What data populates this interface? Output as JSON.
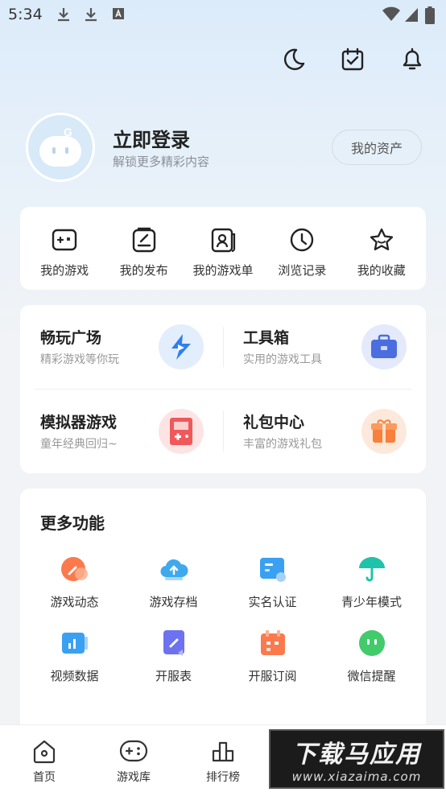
{
  "status_bar": {
    "time": "5:34"
  },
  "top_actions": {
    "night_mode": "moon-icon",
    "checkin": "calendar-check-icon",
    "notifications": "bell-icon"
  },
  "profile": {
    "title": "立即登录",
    "subtitle": "解锁更多精彩内容",
    "assets_button": "我的资产"
  },
  "quick_links": [
    {
      "label": "我的游戏",
      "icon": "gamepad-icon"
    },
    {
      "label": "我的发布",
      "icon": "edit-icon"
    },
    {
      "label": "我的游戏单",
      "icon": "game-list-icon"
    },
    {
      "label": "浏览记录",
      "icon": "clock-icon"
    },
    {
      "label": "我的收藏",
      "icon": "star-icon"
    }
  ],
  "features": [
    {
      "title": "畅玩广场",
      "subtitle": "精彩游戏等你玩",
      "icon": "lightning-play-icon",
      "color": "#2f7ff0"
    },
    {
      "title": "工具箱",
      "subtitle": "实用的游戏工具",
      "icon": "toolbox-icon",
      "color": "#4a6ee0"
    },
    {
      "title": "模拟器游戏",
      "subtitle": "童年经典回归~",
      "icon": "emulator-icon",
      "color": "#f0585a"
    },
    {
      "title": "礼包中心",
      "subtitle": "丰富的游戏礼包",
      "icon": "gift-icon",
      "color": "#f7803c"
    }
  ],
  "more": {
    "title": "更多功能",
    "items": [
      {
        "label": "游戏动态",
        "icon": "game-news-icon",
        "color": "#fa7a4e"
      },
      {
        "label": "游戏存档",
        "icon": "cloud-upload-icon",
        "color": "#3fa9ee"
      },
      {
        "label": "实名认证",
        "icon": "id-card-icon",
        "color": "#3aa0f2"
      },
      {
        "label": "青少年模式",
        "icon": "umbrella-icon",
        "color": "#1fc3a9"
      },
      {
        "label": "视频数据",
        "icon": "video-data-icon",
        "color": "#3aa0f2"
      },
      {
        "label": "开服表",
        "icon": "server-list-icon",
        "color": "#6c72f0"
      },
      {
        "label": "开服订阅",
        "icon": "subscribe-calendar-icon",
        "color": "#fa7a4e"
      },
      {
        "label": "微信提醒",
        "icon": "wechat-icon",
        "color": "#2ec45c"
      }
    ]
  },
  "tabbar": [
    {
      "label": "首页",
      "icon": "home-icon"
    },
    {
      "label": "游戏库",
      "icon": "game-library-icon"
    },
    {
      "label": "排行榜",
      "icon": "ranking-icon"
    }
  ],
  "watermark": {
    "line1": "下载马应用",
    "line2": "www.xiazaima.com"
  }
}
